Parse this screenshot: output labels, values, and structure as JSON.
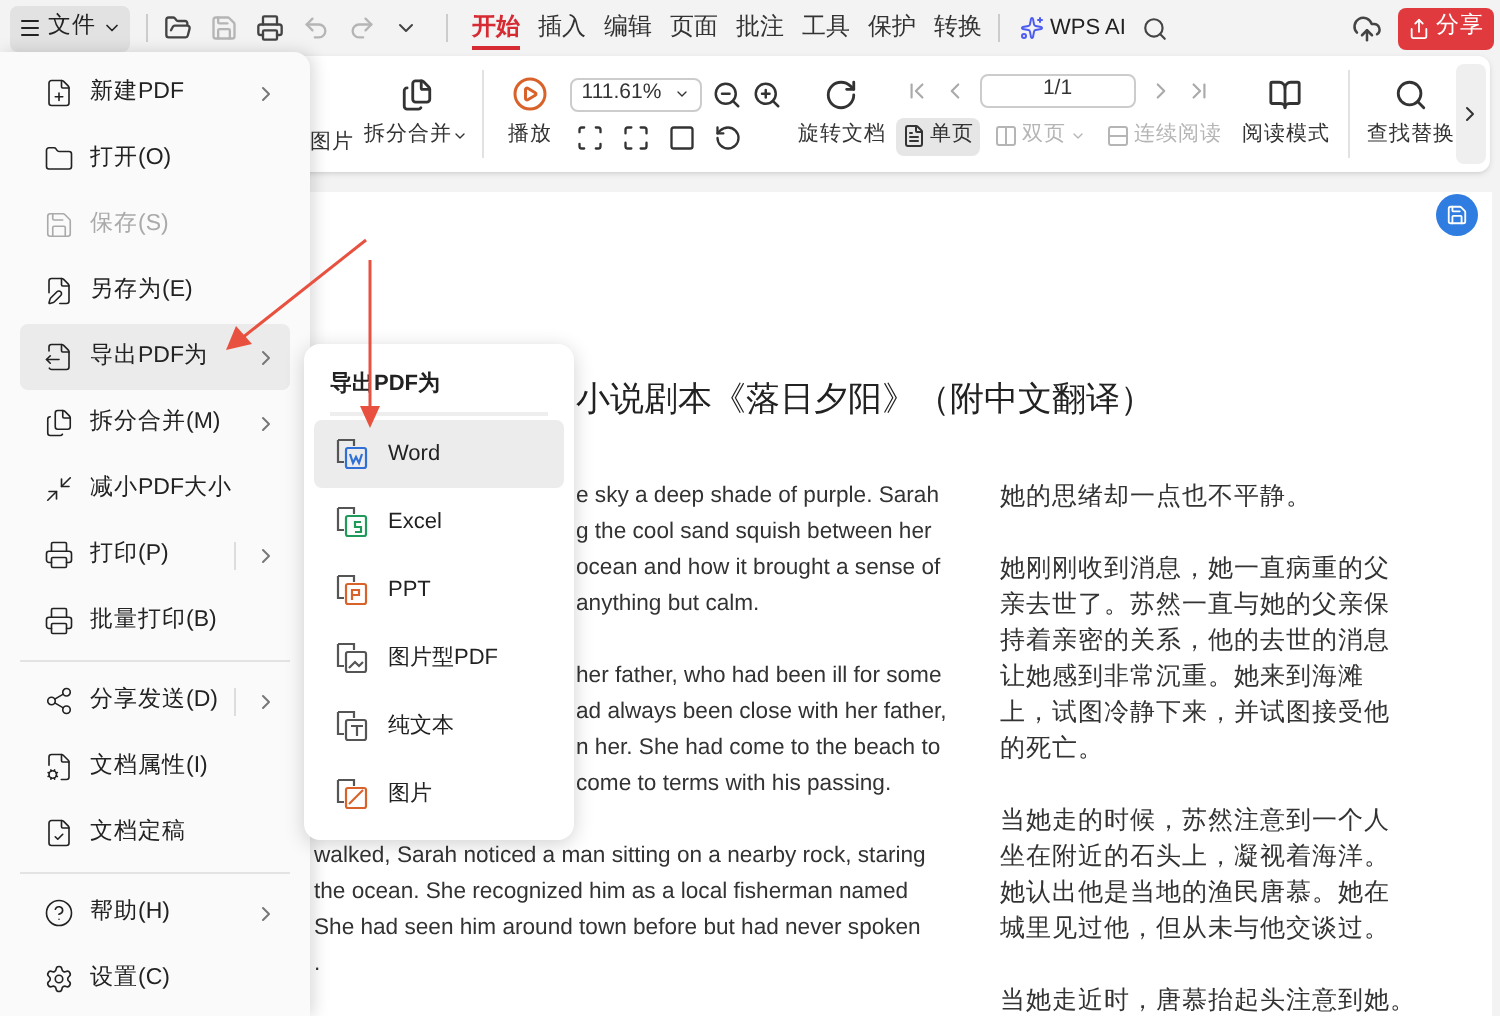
{
  "top_bar": {
    "file_button": "文件",
    "quick_access": [
      {
        "disabled": false
      },
      {
        "disabled": true
      },
      {
        "disabled": false
      },
      {
        "disabled": true
      },
      {
        "disabled": true
      }
    ],
    "tabs": [
      {
        "label": "开始",
        "selected": true
      },
      {
        "label": "插入",
        "selected": false
      },
      {
        "label": "编辑",
        "selected": false
      },
      {
        "label": "页面",
        "selected": false
      },
      {
        "label": "批注",
        "selected": false
      },
      {
        "label": "工具",
        "selected": false
      },
      {
        "label": "保护",
        "selected": false
      },
      {
        "label": "转换",
        "selected": false
      }
    ],
    "ai_button": "WPS AI",
    "share_button": "分享"
  },
  "ribbon": {
    "partial_label": "图片",
    "split_merge": "拆分合并",
    "play": "播放",
    "zoom": "111.61%",
    "rotate": "旋转文档",
    "page": "1/1",
    "view_modes": [
      {
        "label": "单页",
        "selected": true,
        "disabled": false
      },
      {
        "label": "双页",
        "selected": false,
        "disabled": true
      },
      {
        "label": "连续阅读",
        "selected": false,
        "disabled": true
      }
    ],
    "reading_mode": "阅读模式",
    "find_replace": "查找替换"
  },
  "file_menu": {
    "groups": [
      [
        {
          "label": "新建PDF",
          "kind": "submenu",
          "disabled": false,
          "selected": false
        },
        {
          "label": "打开(O)",
          "kind": "plain",
          "disabled": false,
          "selected": false
        },
        {
          "label": "保存(S)",
          "kind": "plain",
          "disabled": true,
          "selected": false
        },
        {
          "label": "另存为(E)",
          "kind": "plain",
          "disabled": false,
          "selected": false
        },
        {
          "label": "导出PDF为",
          "kind": "submenu",
          "disabled": false,
          "selected": true
        },
        {
          "label": "拆分合并(M)",
          "kind": "submenu",
          "disabled": false,
          "selected": false
        },
        {
          "label": "减小PDF大小",
          "kind": "plain",
          "disabled": false,
          "selected": false
        },
        {
          "label": "打印(P)",
          "kind": "split",
          "disabled": false,
          "selected": false
        },
        {
          "label": "批量打印(B)",
          "kind": "plain",
          "disabled": false,
          "selected": false
        }
      ],
      [
        {
          "label": "分享发送(D)",
          "kind": "split",
          "disabled": false,
          "selected": false
        },
        {
          "label": "文档属性(I)",
          "kind": "plain",
          "disabled": false,
          "selected": false
        },
        {
          "label": "文档定稿",
          "kind": "plain",
          "disabled": false,
          "selected": false
        }
      ],
      [
        {
          "label": "帮助(H)",
          "kind": "submenu",
          "disabled": false,
          "selected": false
        },
        {
          "label": "设置(C)",
          "kind": "plain",
          "disabled": false,
          "selected": false
        }
      ]
    ]
  },
  "export_submenu": {
    "title": "导出PDF为",
    "items": [
      {
        "label": "Word",
        "selected": true
      },
      {
        "label": "Excel",
        "selected": false
      },
      {
        "label": "PPT",
        "selected": false
      },
      {
        "label": "图片型PDF",
        "selected": false
      },
      {
        "label": "纯文本",
        "selected": false
      },
      {
        "label": "图片",
        "selected": false
      }
    ]
  },
  "document": {
    "title": "小说剧本《落日夕阳》（附中文翻译）",
    "left_column": {
      "partial_paragraphs": [
        [
          "e sky a deep shade of purple. Sarah",
          "g the cool sand squish between her",
          "ocean and how it brought a sense of",
          "anything but calm."
        ],
        [
          "her father, who had been ill for some",
          "ad always been close with her father,",
          "n her. She had come to the beach to",
          "come to terms with his passing."
        ]
      ],
      "paragraphs": [
        [
          "walked, Sarah noticed a man sitting on a nearby rock, staring",
          "the ocean. She recognized him as a local fisherman named",
          "She had seen him around town before but had never spoken",
          "."
        ]
      ]
    },
    "right_column": [
      "她的思绪却一点也不平静。",
      "她刚刚收到消息，她一直病重的父亲去世了。苏然一直与她的父亲保持着亲密的关系，他的去世的消息让她感到非常沉重。她来到海滩上，试图冷静下来，并试图接受他的死亡。",
      "当她走的时候，苏然注意到一个人坐在附近的石头上，凝视着海洋。她认出他是当地的渔民唐慕。她在城里见过他，但从未与他交谈过。",
      "当她走近时，唐慕抬起头注意到她。"
    ]
  }
}
